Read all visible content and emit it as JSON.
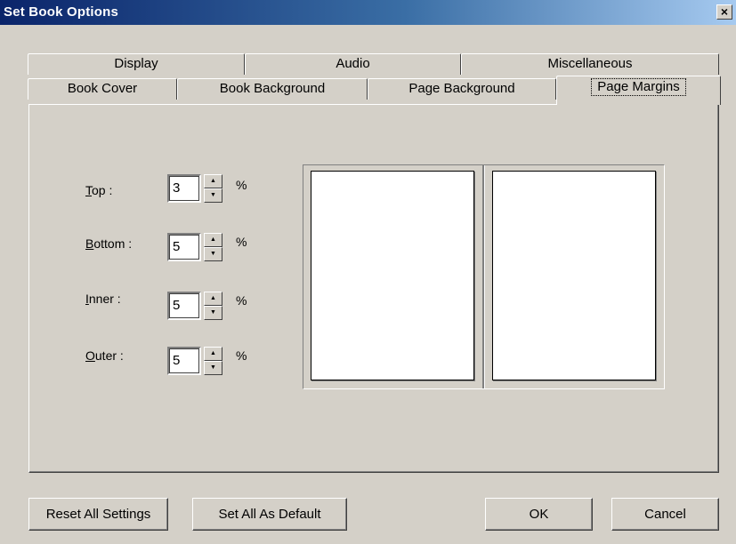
{
  "window": {
    "title": "Set Book Options",
    "close_label": "×"
  },
  "tabs": {
    "back_row": [
      "Display",
      "Audio",
      "Miscellaneous"
    ],
    "front_row": [
      "Book Cover",
      "Book Background",
      "Page Background",
      "Page Margins"
    ],
    "active": "Page Margins"
  },
  "margins": {
    "top": {
      "label_key": "T",
      "label_rest": "op :",
      "value": "3",
      "unit": "%"
    },
    "bottom": {
      "label_key": "B",
      "label_rest": "ottom :",
      "value": "5",
      "unit": "%"
    },
    "inner": {
      "label_key": "I",
      "label_rest": "nner :",
      "value": "5",
      "unit": "%"
    },
    "outer": {
      "label_key": "O",
      "label_rest": "uter :",
      "value": "5",
      "unit": "%"
    }
  },
  "spin": {
    "up_glyph": "▲",
    "down_glyph": "▼"
  },
  "buttons": {
    "reset": "Reset All Settings",
    "default": "Set All As Default",
    "ok": "OK",
    "cancel": "Cancel"
  }
}
